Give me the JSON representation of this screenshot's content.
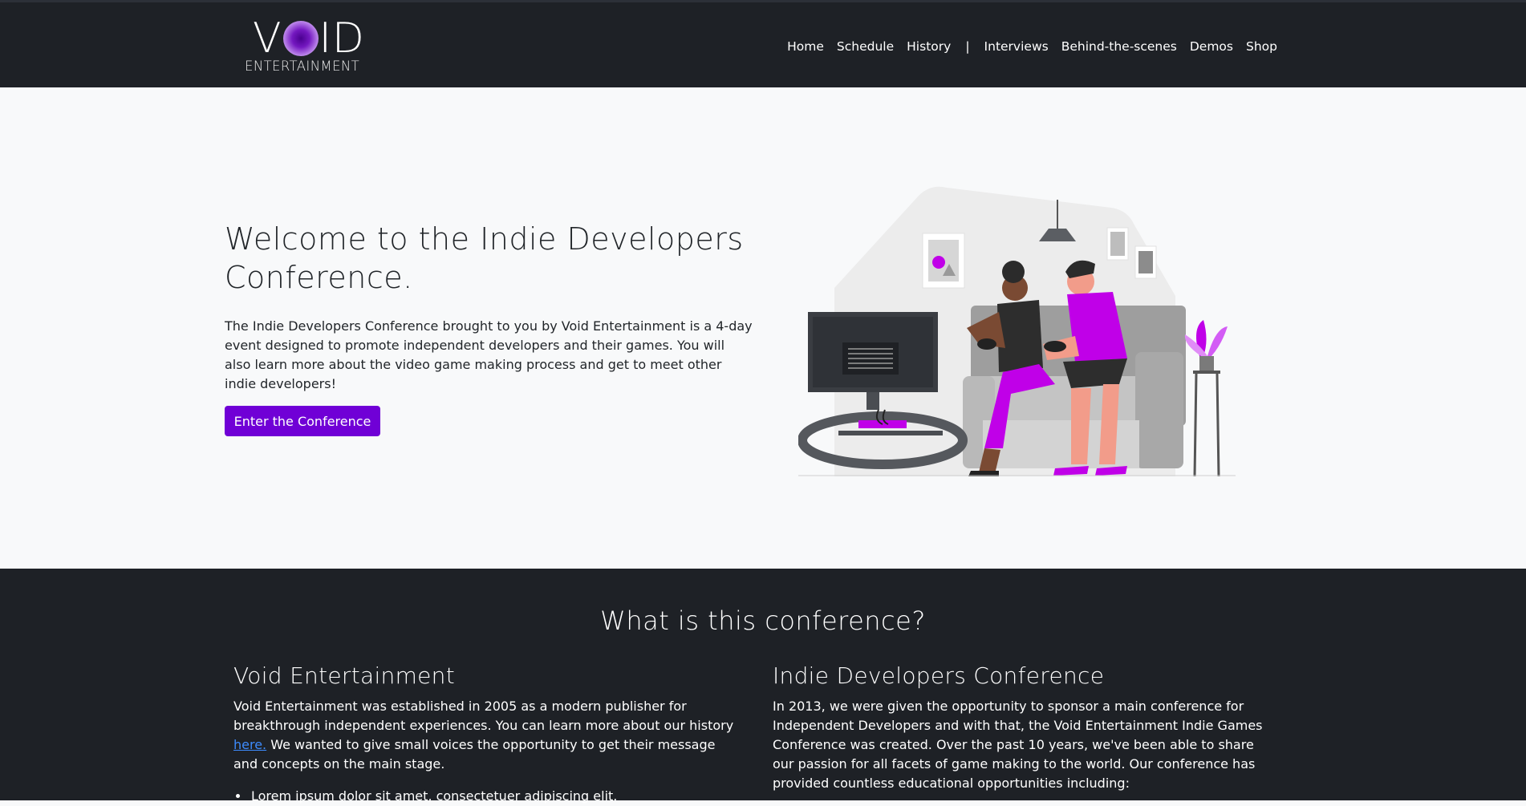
{
  "brand": {
    "logo_main": "VOID",
    "logo_sub": "ENTERTAINMENT"
  },
  "nav": {
    "items": [
      "Home",
      "Schedule",
      "History",
      "Interviews",
      "Behind-the-scenes",
      "Demos",
      "Shop"
    ],
    "separator": "|"
  },
  "hero": {
    "title": "Welcome to the Indie Developers Conference.",
    "text": "The Indie Developers Conference brought to you by Void Entertainment is a 4-day event designed to promote independent developers and their games. You will also learn more about the video game making process and get to meet other indie developers!",
    "button_label": "Enter the Conference",
    "illustration": "two-people-playing-video-games-on-couch"
  },
  "about": {
    "title": "What is this conference?",
    "left": {
      "heading": "Void Entertainment",
      "text_before_link": "Void Entertainment was established in 2005 as a modern publisher for breakthrough independent experiences. You can learn more about our history ",
      "link_text": "here.",
      "text_after_link": " We wanted to give small voices the opportunity to get their message and concepts on the main stage.",
      "list": [
        "Lorem ipsum dolor sit amet, consectetuer adipiscing elit."
      ]
    },
    "right": {
      "heading": "Indie Developers Conference",
      "text": "In 2013, we were given the opportunity to sponsor a main conference for Independent Developers and with that, the Void Entertainment Indie Games Conference was created. Over the past 10 years, we've been able to share our passion for all facets of game making to the world. Our conference has provided countless educational opportunities including:"
    }
  },
  "colors": {
    "navbar_bg": "#1e2126",
    "hero_bg": "#f8f9fa",
    "accent": "#7000d6",
    "illustration_purple": "#c000e8",
    "link": "#3d8bfd"
  }
}
